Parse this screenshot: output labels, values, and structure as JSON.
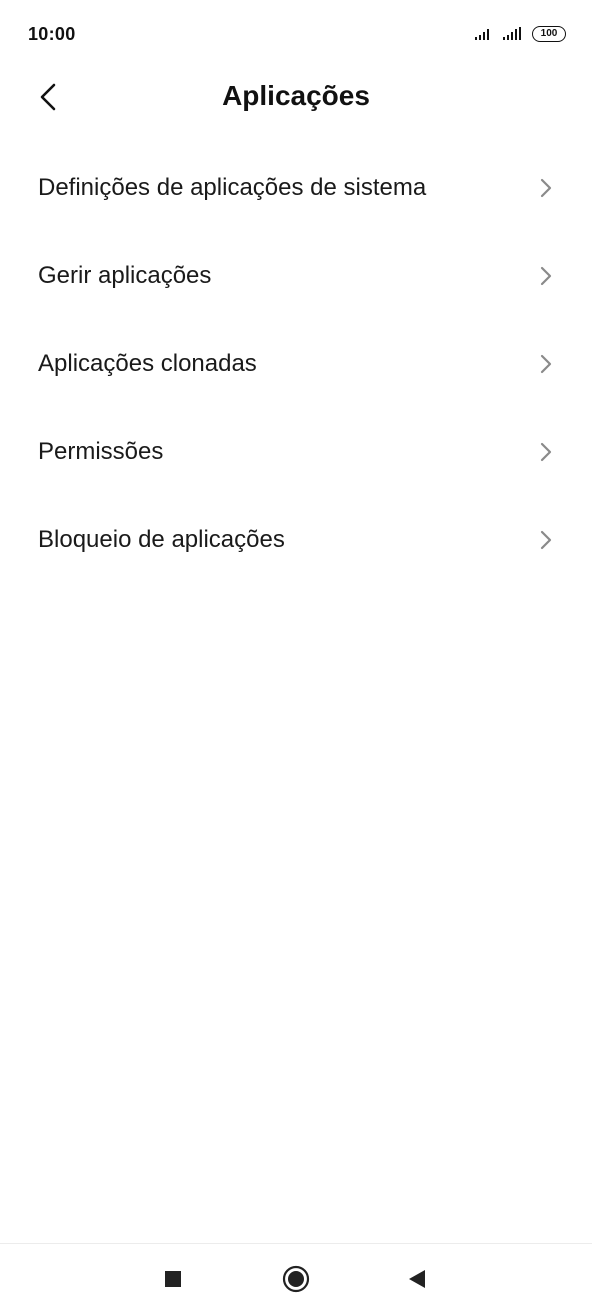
{
  "status_bar": {
    "time": "10:00",
    "battery": "100",
    "icons": [
      "signal-icon",
      "signal-icon",
      "battery-icon"
    ]
  },
  "header": {
    "title": "Aplicações",
    "back_icon": "back-arrow-icon"
  },
  "menu": {
    "items": [
      {
        "label": "Definições de aplicações de sistema",
        "icon": "chevron-right-icon"
      },
      {
        "label": "Gerir aplicações",
        "icon": "chevron-right-icon"
      },
      {
        "label": "Aplicações clonadas",
        "icon": "chevron-right-icon"
      },
      {
        "label": "Permissões",
        "icon": "chevron-right-icon"
      },
      {
        "label": "Bloqueio de aplicações",
        "icon": "chevron-right-icon"
      }
    ]
  },
  "nav_bar": {
    "icons": [
      "recents-square-icon",
      "home-circle-icon",
      "back-triangle-icon"
    ]
  },
  "colors": {
    "text": "#1a1a1a",
    "chevron": "#8a8a8a",
    "background": "#ffffff"
  }
}
